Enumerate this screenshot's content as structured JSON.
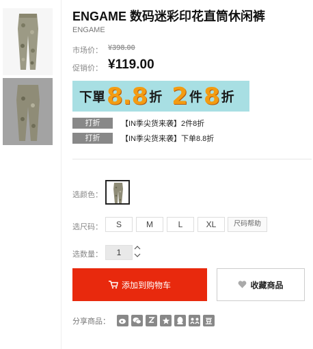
{
  "product": {
    "title": "ENGAME 数码迷彩印花直筒休闲裤",
    "brand": "ENGAME",
    "market_price_label": "市场价：",
    "market_price": "¥398.00",
    "promo_price_label": "促销价：",
    "promo_price": "¥119.00"
  },
  "banner": {
    "part1": "下單",
    "part2": "8.8",
    "part3": "折",
    "part4": "2",
    "part5": "件",
    "part6": "8",
    "part7": "折"
  },
  "promotions": [
    {
      "tag": "打折",
      "text": "【IN季尖货来袭】2件8折"
    },
    {
      "tag": "打折",
      "text": "【IN季尖货来袭】下单8.8折"
    }
  ],
  "options": {
    "color_label": "选颜色：",
    "size_label": "选尺码：",
    "sizes": [
      "S",
      "M",
      "L",
      "XL"
    ],
    "size_help": "尺码帮助",
    "qty_label": "选数量：",
    "qty_value": "1",
    "qty_up": "^",
    "qty_down": "v"
  },
  "actions": {
    "add_to_cart": "添加到购物车",
    "favorite": "收藏商品"
  },
  "share": {
    "label": "分享商品：",
    "icons": [
      "weibo-icon",
      "wechat-icon",
      "qzone-icon",
      "star-icon",
      "qq-icon",
      "renren-icon",
      "douban-icon"
    ],
    "douban_text": "豆"
  },
  "colors": {
    "accent_red": "#e8290d",
    "banner_bg": "#a8dfe3",
    "banner_orange": "#f39c12"
  }
}
